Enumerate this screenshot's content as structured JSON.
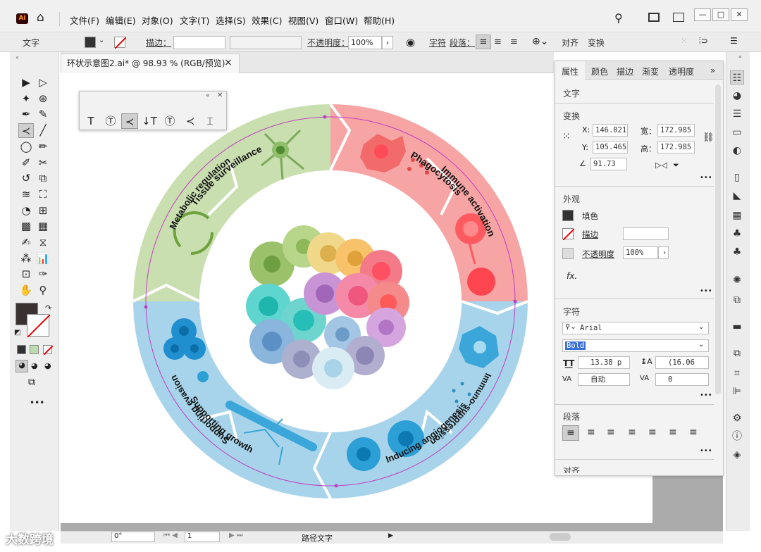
{
  "app": {
    "logo": "Ai",
    "menus": [
      "文件(F)",
      "编辑(E)",
      "对象(O)",
      "文字(T)",
      "选择(S)",
      "效果(C)",
      "视图(V)",
      "窗口(W)",
      "帮助(H)"
    ],
    "window_buttons": [
      "—",
      "□",
      "✕"
    ]
  },
  "control_bar": {
    "mode": "文字",
    "stroke_label": "描边：",
    "opacity_label": "不透明度：",
    "opacity_value": "100%",
    "char_label": "字符",
    "para_label": "段落：",
    "align_label": "对齐",
    "transform_label": "变换"
  },
  "document": {
    "tab_title": "环状示意图2.ai* @ 98.93 % (RGB/预览)",
    "close": "×"
  },
  "status": {
    "angle": "0°",
    "page": "1",
    "tool_name": "路径文字"
  },
  "figure": {
    "segments": [
      "Tissue surveillance",
      "Phagocytosis",
      "Immune activation",
      "Immuno-suppression",
      "Supporting growth",
      "Inducing angiogenesis",
      "Supporting evasion",
      "Metabolic regulation"
    ]
  },
  "props": {
    "tabs": [
      "属性",
      "颜色",
      "描边",
      "渐变",
      "透明度"
    ],
    "section_text": "文字",
    "transform": {
      "title": "变换",
      "x_label": "X:",
      "x": "146.021",
      "y_label": "Y:",
      "y": "105.465",
      "w_label": "宽：",
      "w": "172.985",
      "h_label": "高：",
      "h": "172.985",
      "angle": "91.73"
    },
    "appearance": {
      "title": "外观",
      "fill": "填色",
      "stroke": "描边",
      "opacity": "不透明度",
      "opacity_value": "100%",
      "fx": "fx."
    },
    "character": {
      "title": "字符",
      "font": "Arial",
      "style": "Bold",
      "size": "13.38 p",
      "leading": "(16.06",
      "kerning": "自动",
      "tracking": "0"
    },
    "paragraph": {
      "title": "段落"
    },
    "align": {
      "title": "对齐"
    }
  },
  "watermark": "大数跨境",
  "colors": {
    "green": "#c8dfae",
    "pink": "#f6a5a5",
    "blue": "#a9d6ea",
    "magenta": "#c23fc4"
  }
}
